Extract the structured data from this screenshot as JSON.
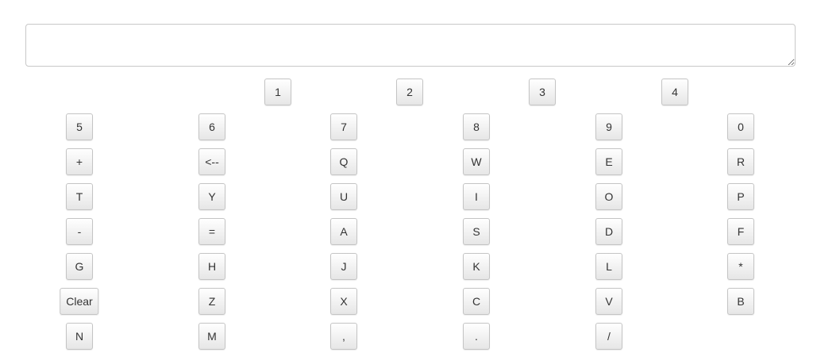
{
  "input": {
    "value": "",
    "placeholder": ""
  },
  "keyboard": {
    "rows": [
      [
        "1",
        "2",
        "3",
        "4"
      ],
      [
        "5",
        "6",
        "7",
        "8",
        "9",
        "0"
      ],
      [
        "+",
        "<--",
        "Q",
        "W",
        "E",
        "R"
      ],
      [
        "T",
        "Y",
        "U",
        "I",
        "O",
        "P"
      ],
      [
        "-",
        "=",
        "A",
        "S",
        "D",
        "F"
      ],
      [
        "G",
        "H",
        "J",
        "K",
        "L",
        "*"
      ],
      [
        "Clear",
        "Z",
        "X",
        "C",
        "V",
        "B"
      ],
      [
        "N",
        "M",
        ",",
        ".",
        "/"
      ]
    ]
  },
  "colors": {
    "key_border": "#c4c4c4",
    "key_text": "#333333",
    "input_border": "#c8c8c8"
  }
}
